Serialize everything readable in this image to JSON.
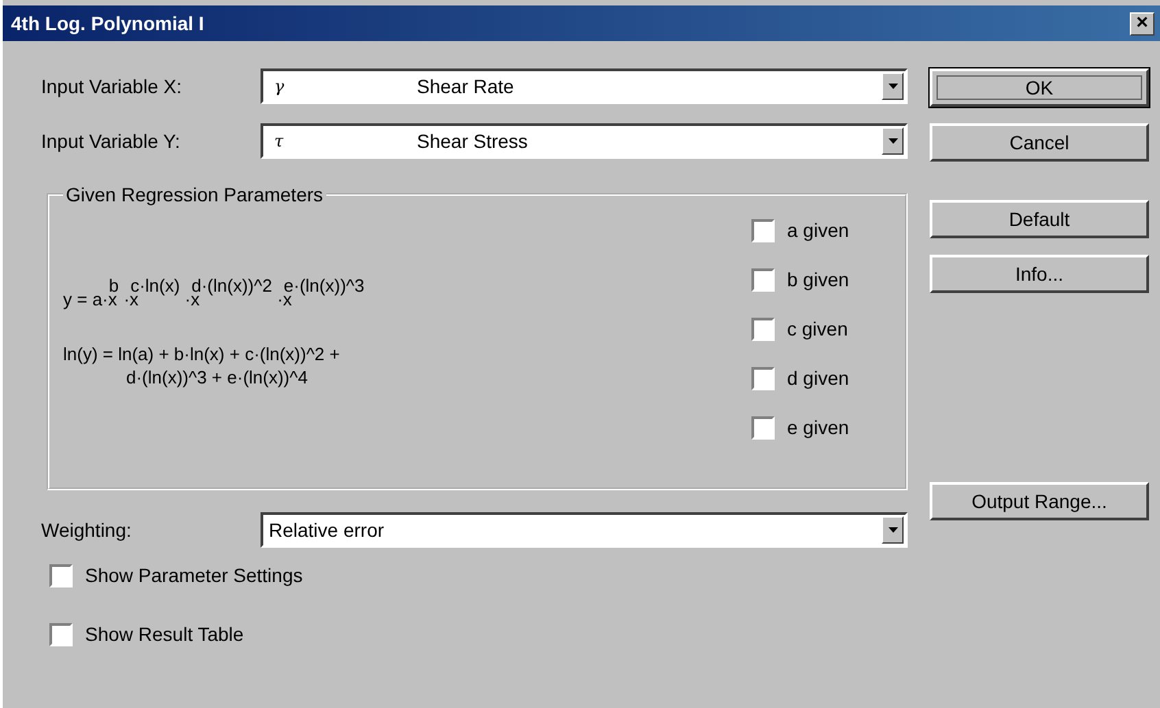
{
  "window": {
    "title": "4th Log. Polynomial I",
    "close": "×"
  },
  "inputs": [
    {
      "label": "Input Variable X:",
      "symbol": "γ",
      "value": "Shear Rate"
    },
    {
      "label": "Input Variable Y:",
      "symbol": "τ",
      "value": "Shear Stress"
    }
  ],
  "group": {
    "title": "Given Regression Parameters",
    "formula_1": "y = a·x$^{b}$ ·x$^{c·ln(x)}$ ·x$^{d·(ln(x))^2}$ ·x$^{e·(ln(x))^3}$",
    "formula_2": [
      "ln(y) = ln(a) + b·ln(x) + c·(ln(x))^2 +",
      "d·(ln(x))^3 + e·(ln(x))^4"
    ],
    "checks": [
      {
        "label": "a given",
        "checked": false
      },
      {
        "label": "b given",
        "checked": false
      },
      {
        "label": "c given",
        "checked": false
      },
      {
        "label": "d given",
        "checked": false
      },
      {
        "label": "e given",
        "checked": false
      }
    ]
  },
  "weighting": {
    "label": "Weighting:",
    "value": "Relative error"
  },
  "options": [
    {
      "label": "Show Parameter Settings",
      "checked": false
    },
    {
      "label": "Show Result Table",
      "checked": false
    }
  ],
  "buttons": [
    {
      "label": "OK",
      "kind": "default"
    },
    {
      "label": "Cancel",
      "kind": "plain"
    },
    {
      "label": "Default",
      "kind": "plain"
    },
    {
      "label": "Info...",
      "kind": "plain"
    },
    {
      "label": "Output Range...",
      "kind": "bottom"
    }
  ]
}
